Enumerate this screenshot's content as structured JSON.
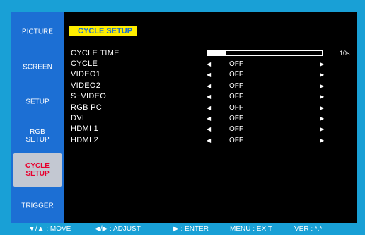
{
  "sidebar": {
    "items": [
      {
        "label": "PICTURE"
      },
      {
        "label": "SCREEN"
      },
      {
        "label": "SETUP"
      },
      {
        "label": "RGB\nSETUP"
      },
      {
        "label": "CYCLE\nSETUP",
        "active": true
      },
      {
        "label": "TRIGGER"
      }
    ]
  },
  "menu": {
    "title": "CYCLE SETUP",
    "cycle_time": {
      "label": "CYCLE TIME",
      "value": "10s",
      "level_fraction": 0.16
    },
    "rows": [
      {
        "label": "CYCLE",
        "left_arrow": "◀",
        "value": "OFF",
        "right_arrow": "▶"
      },
      {
        "label": "VIDEO1",
        "left_arrow": "◀",
        "value": "OFF",
        "right_arrow": "▶"
      },
      {
        "label": "VIDEO2",
        "left_arrow": "◀",
        "value": "OFF",
        "right_arrow": "▶"
      },
      {
        "label": "S−VIDEO",
        "left_arrow": "◀",
        "value": "OFF",
        "right_arrow": "▶"
      },
      {
        "label": "RGB PC",
        "left_arrow": "◀",
        "value": "OFF",
        "right_arrow": "▶"
      },
      {
        "label": "DVI",
        "left_arrow": "◀",
        "value": "OFF",
        "right_arrow": "▶"
      },
      {
        "label": "HDMI 1",
        "left_arrow": "◀",
        "value": "OFF",
        "right_arrow": "▶"
      },
      {
        "label": "HDMI 2",
        "left_arrow": "◀",
        "value": "OFF",
        "right_arrow": "▶"
      }
    ]
  },
  "hints": {
    "move": "▼/▲ : MOVE",
    "adjust": "◀/▶ : ADJUST",
    "enter": "▶ : ENTER",
    "exit": "MENU : EXIT",
    "version": "VER : *.*"
  },
  "colors": {
    "background": "#19a0d6",
    "sidebar": "#1c6fd4",
    "title_bg": "#ffee00",
    "active_text": "#e8002e"
  }
}
